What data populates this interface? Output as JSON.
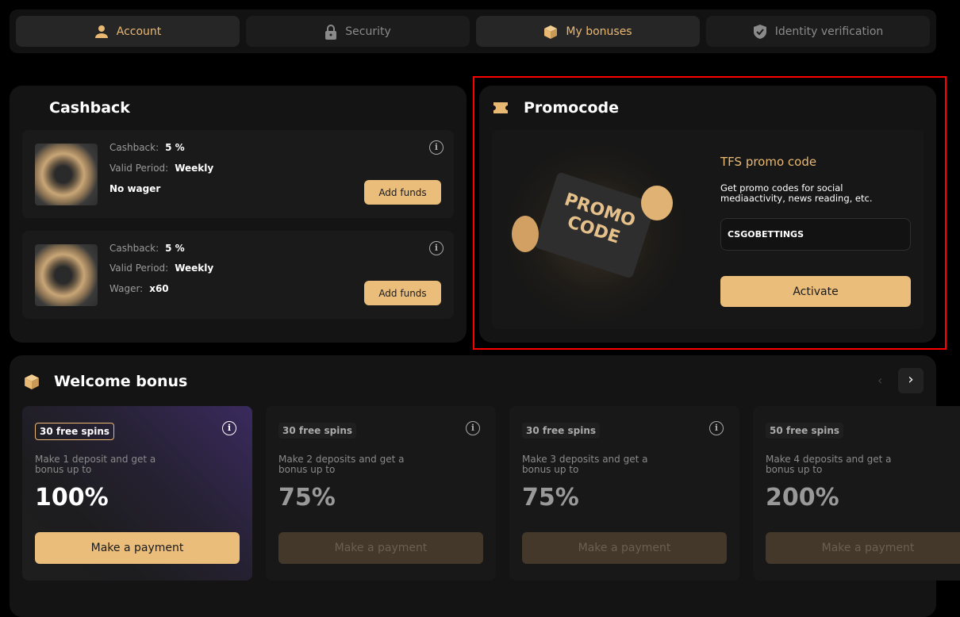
{
  "tabs": [
    {
      "label": "Account",
      "icon": "user-icon",
      "active": true
    },
    {
      "label": "Security",
      "icon": "lock-icon",
      "active": false
    },
    {
      "label": "My bonuses",
      "icon": "box-icon",
      "active": true
    },
    {
      "label": "Identity verification",
      "icon": "shield-check-icon",
      "active": false
    }
  ],
  "cashback": {
    "title": "Cashback",
    "items": [
      {
        "cashback_label": "Cashback:",
        "cashback_value": "5 %",
        "period_label": "Valid Period:",
        "period_value": "Weekly",
        "wager_text": "No wager",
        "button": "Add funds"
      },
      {
        "cashback_label": "Cashback:",
        "cashback_value": "5 %",
        "period_label": "Valid Period:",
        "period_value": "Weekly",
        "wager_label": "Wager:",
        "wager_value": "x60",
        "button": "Add funds"
      }
    ]
  },
  "promo": {
    "title": "Promocode",
    "subtitle": "TFS promo code",
    "description": "Get promo codes for social mediaactivity, news reading, etc.",
    "input_value": "CSGOBETTINGS",
    "button": "Activate",
    "image_text": "PROMO CODE"
  },
  "welcome": {
    "title": "Welcome bonus",
    "cards": [
      {
        "badge": "30 free spins",
        "desc": "Make 1 deposit and get a bonus up to",
        "value": "100%",
        "button": "Make a payment"
      },
      {
        "badge": "30 free spins",
        "desc": "Make 2 deposits and get a bonus up to",
        "value": "75%",
        "button": "Make a payment"
      },
      {
        "badge": "30 free spins",
        "desc": "Make 3 deposits and get a bonus up to",
        "value": "75%",
        "button": "Make a payment"
      },
      {
        "badge": "50 free spins",
        "desc": "Make 4 deposits and get a bonus up to",
        "value": "200%",
        "button": "Make a payment"
      }
    ]
  },
  "colors": {
    "accent": "#ebbd7b",
    "highlight": "#ff0000"
  }
}
